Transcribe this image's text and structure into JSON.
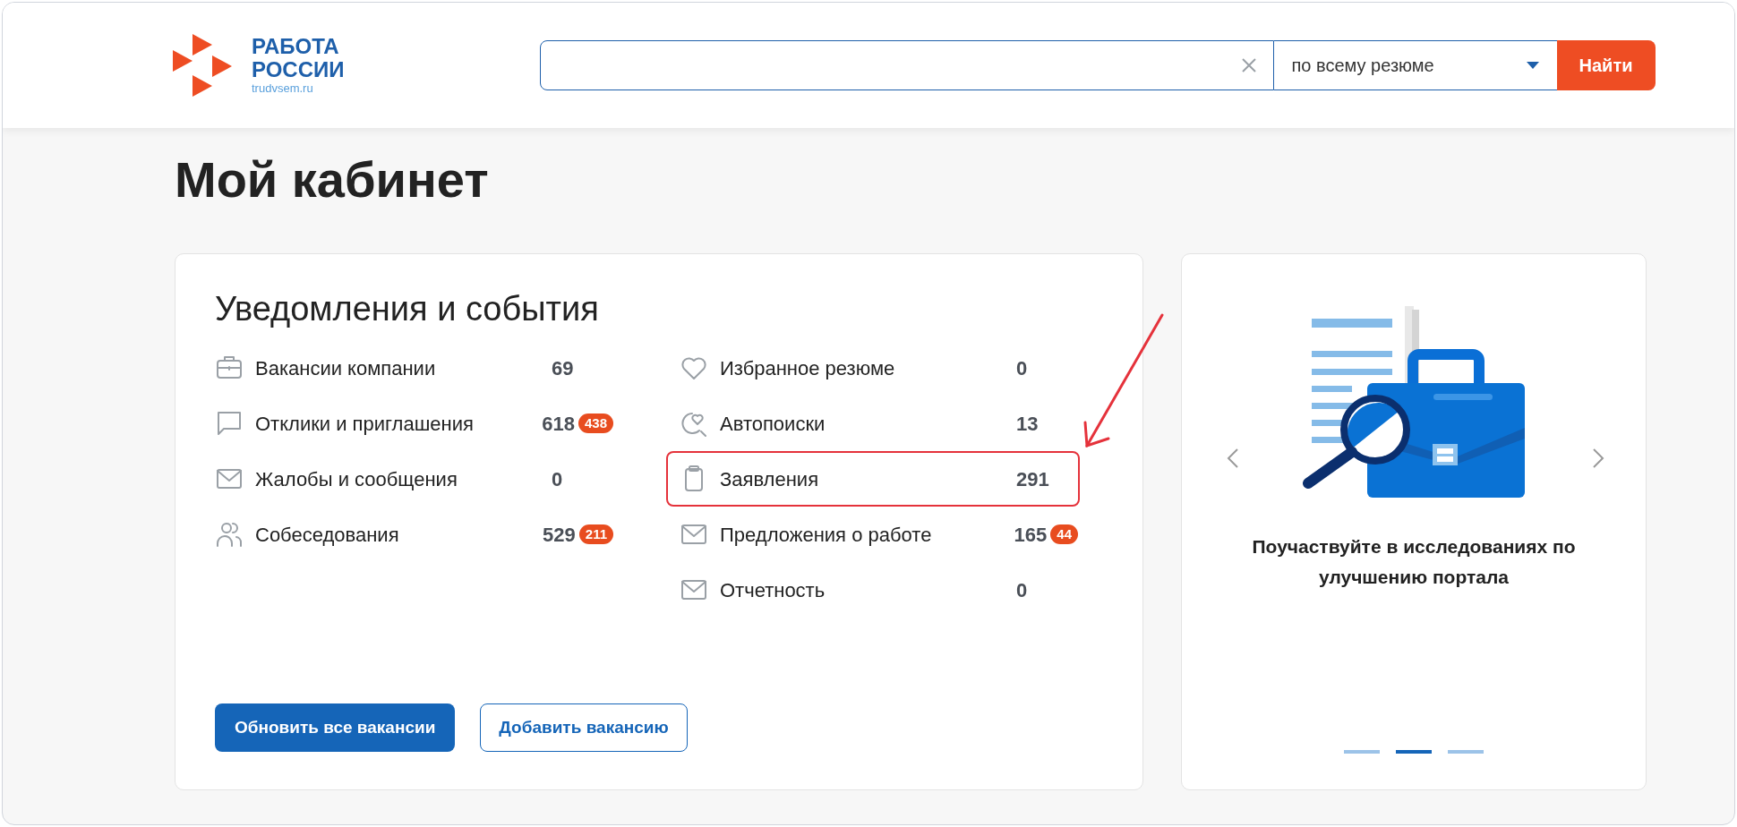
{
  "header": {
    "logo": {
      "line_1": "РАБОТА",
      "line_2": "РОССИИ",
      "domain": "trudvsem.ru"
    },
    "search": {
      "scope": "по всему резюме",
      "button": "Найти"
    }
  },
  "page_title": "Мой кабинет",
  "notifications": {
    "title": "Уведомления и события",
    "columns": [
      [
        {
          "kind": "briefcase",
          "label": "Вакансии компании",
          "count": "69",
          "highlighted": false
        },
        {
          "kind": "chat",
          "label": "Отклики и приглашения",
          "count": "618",
          "badge": "438",
          "highlighted": false
        },
        {
          "kind": "mail",
          "label": "Жалобы и сообщения",
          "count": "0",
          "highlighted": false
        },
        {
          "kind": "people",
          "label": "Собеседования",
          "count": "529",
          "badge": "211",
          "highlighted": false
        }
      ],
      [
        {
          "kind": "heart",
          "label": "Избранное резюме",
          "count": "0",
          "highlighted": false
        },
        {
          "kind": "heart-search",
          "label": "Автопоиски",
          "count": "13",
          "highlighted": false
        },
        {
          "kind": "clipboard",
          "label": "Заявления",
          "count": "291",
          "highlighted": true
        },
        {
          "kind": "mail",
          "label": "Предложения о работе",
          "count": "165",
          "badge": "44",
          "highlighted": false
        },
        {
          "kind": "mail",
          "label": "Отчетность",
          "count": "0",
          "highlighted": false
        }
      ]
    ],
    "buttons": [
      {
        "label": "Обновить все вакансии",
        "kind": "primary"
      },
      {
        "label": "Добавить вакансию",
        "kind": "secondary"
      }
    ]
  },
  "carousel": {
    "caption": "Поучаствуйте в исследованиях по улучшению портала",
    "slides": [
      {
        "selected": false
      },
      {
        "selected": true
      },
      {
        "selected": false
      }
    ]
  }
}
